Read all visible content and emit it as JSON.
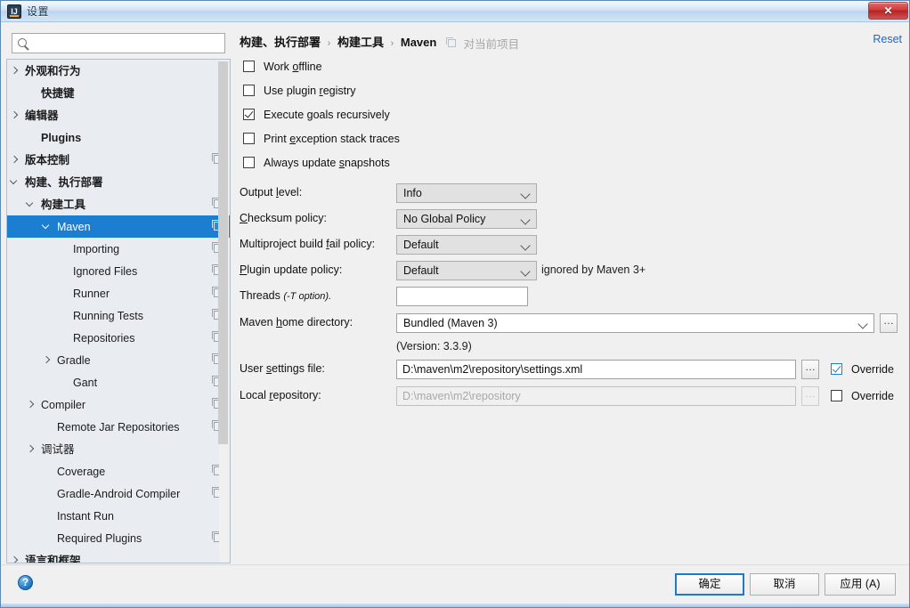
{
  "window": {
    "title": "设置",
    "app_icon": "intellij-idea-icon",
    "close_label": "close-icon"
  },
  "search": {
    "value": "",
    "placeholder": "",
    "icon": "search-icon"
  },
  "sidebar": {
    "items": [
      {
        "label": "外观和行为",
        "indent": 8,
        "arrow": "right",
        "bold": true,
        "copy": false,
        "selected": false
      },
      {
        "label": "快捷键",
        "indent": 26,
        "arrow": "none",
        "bold": true,
        "copy": false,
        "selected": false
      },
      {
        "label": "编辑器",
        "indent": 8,
        "arrow": "right",
        "bold": true,
        "copy": false,
        "selected": false
      },
      {
        "label": "Plugins",
        "indent": 26,
        "arrow": "none",
        "bold": true,
        "copy": false,
        "selected": false
      },
      {
        "label": "版本控制",
        "indent": 8,
        "arrow": "right",
        "bold": true,
        "copy": true,
        "selected": false
      },
      {
        "label": "构建、执行部署",
        "indent": 8,
        "arrow": "down",
        "bold": true,
        "copy": false,
        "selected": false
      },
      {
        "label": "构建工具",
        "indent": 26,
        "arrow": "down",
        "bold": true,
        "copy": true,
        "selected": false
      },
      {
        "label": "Maven",
        "indent": 44,
        "arrow": "down",
        "bold": false,
        "copy": true,
        "selected": true
      },
      {
        "label": "Importing",
        "indent": 62,
        "arrow": "none",
        "bold": false,
        "copy": true,
        "selected": false
      },
      {
        "label": "Ignored Files",
        "indent": 62,
        "arrow": "none",
        "bold": false,
        "copy": true,
        "selected": false
      },
      {
        "label": "Runner",
        "indent": 62,
        "arrow": "none",
        "bold": false,
        "copy": true,
        "selected": false
      },
      {
        "label": "Running Tests",
        "indent": 62,
        "arrow": "none",
        "bold": false,
        "copy": true,
        "selected": false
      },
      {
        "label": "Repositories",
        "indent": 62,
        "arrow": "none",
        "bold": false,
        "copy": true,
        "selected": false
      },
      {
        "label": "Gradle",
        "indent": 44,
        "arrow": "right",
        "bold": false,
        "copy": true,
        "selected": false
      },
      {
        "label": "Gant",
        "indent": 62,
        "arrow": "none",
        "bold": false,
        "copy": true,
        "selected": false
      },
      {
        "label": "Compiler",
        "indent": 26,
        "arrow": "right",
        "bold": false,
        "copy": true,
        "selected": false
      },
      {
        "label": "Remote Jar Repositories",
        "indent": 44,
        "arrow": "none",
        "bold": false,
        "copy": true,
        "selected": false
      },
      {
        "label": "调试器",
        "indent": 26,
        "arrow": "right",
        "bold": false,
        "copy": false,
        "selected": false
      },
      {
        "label": "Coverage",
        "indent": 44,
        "arrow": "none",
        "bold": false,
        "copy": true,
        "selected": false
      },
      {
        "label": "Gradle-Android Compiler",
        "indent": 44,
        "arrow": "none",
        "bold": false,
        "copy": true,
        "selected": false
      },
      {
        "label": "Instant Run",
        "indent": 44,
        "arrow": "none",
        "bold": false,
        "copy": false,
        "selected": false
      },
      {
        "label": "Required Plugins",
        "indent": 44,
        "arrow": "none",
        "bold": false,
        "copy": true,
        "selected": false
      },
      {
        "label": "语言和框架",
        "indent": 8,
        "arrow": "right",
        "bold": true,
        "copy": false,
        "selected": false
      }
    ]
  },
  "breadcrumb": {
    "parts": [
      "构建、执行部署",
      "构建工具",
      "Maven"
    ],
    "separator": "›",
    "copy_icon": "copy-icon",
    "scope": "对当前项目"
  },
  "reset": {
    "label": "Reset"
  },
  "main": {
    "checkboxes": [
      {
        "label_pre": "Work ",
        "mnemonic": "o",
        "label_post": "ffline",
        "checked": false
      },
      {
        "label_pre": "Use plugin ",
        "mnemonic": "r",
        "label_post": "egistry",
        "checked": false
      },
      {
        "label_pre": "Execute ",
        "mnemonic": "g",
        "label_post": "oals recursively",
        "checked": true
      },
      {
        "label_pre": "Print ",
        "mnemonic": "e",
        "label_post": "xception stack traces",
        "checked": false
      },
      {
        "label_pre": "Always update ",
        "mnemonic": "s",
        "label_post": "napshots",
        "checked": false
      }
    ],
    "combos": [
      {
        "label_pre": "Output ",
        "mnemonic": "l",
        "label_post": "evel:",
        "value": "Info"
      },
      {
        "label_pre": "",
        "mnemonic": "C",
        "label_post": "hecksum policy:",
        "value": "No Global Policy"
      },
      {
        "label_pre": "Multiproject build ",
        "mnemonic": "f",
        "label_post": "ail policy:",
        "value": "Default"
      },
      {
        "label_pre": "",
        "mnemonic": "P",
        "label_post": "lugin update policy:",
        "value": "Default"
      }
    ],
    "plugin_policy_hint": "ignored by Maven 3+",
    "threads": {
      "label_main": "Threads ",
      "label_italic": "(-T option).",
      "value": ""
    },
    "maven_home": {
      "label_pre": "Maven ",
      "mnemonic": "h",
      "label_post": "ome directory:",
      "value": "Bundled (Maven 3)",
      "browse_label": "...",
      "version_note": "(Version: 3.3.9)"
    },
    "user_settings": {
      "label_pre": "User ",
      "mnemonic": "s",
      "label_post": "ettings file:",
      "value": "D:\\maven\\m2\\repository\\settings.xml",
      "browse_label": "...",
      "override_label": "Override",
      "override_checked": true
    },
    "local_repository": {
      "label_pre": "Local ",
      "mnemonic": "r",
      "label_post": "epository:",
      "value": "D:\\maven\\m2\\repository",
      "browse_label": "...",
      "override_label": "Override",
      "override_checked": false,
      "disabled": true
    }
  },
  "footer": {
    "help_label": "?",
    "ok_label": "确定",
    "cancel_label": "取消",
    "apply_label": "应用 (A)"
  },
  "colors": {
    "selection_blue": "#1c7ed0",
    "link_blue": "#1b66c9",
    "accent_checkbox": "#1a7fd4",
    "close_red": "#cf3b3b"
  }
}
